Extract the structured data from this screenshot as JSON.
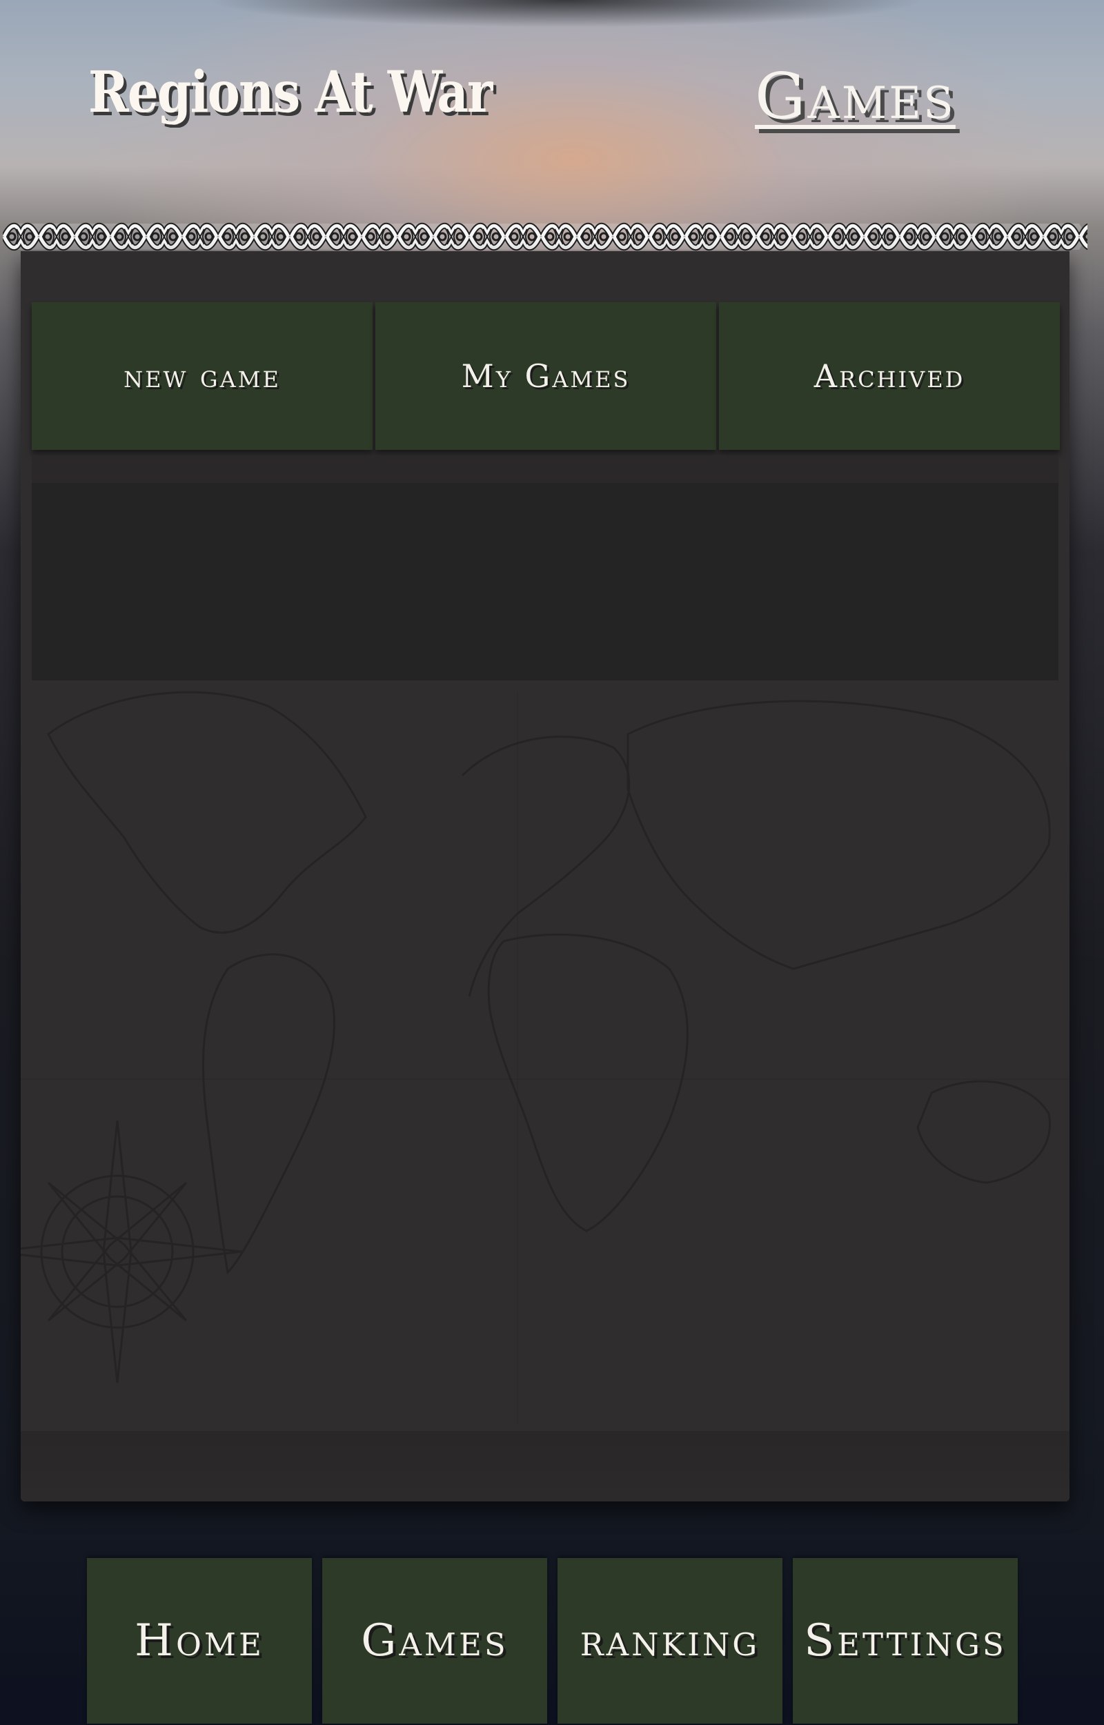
{
  "header": {
    "brand": "Regions At War",
    "nav_link": "Games"
  },
  "tabs": [
    {
      "label": "new game"
    },
    {
      "label": "My Games"
    },
    {
      "label": "Archived"
    }
  ],
  "bottom_nav": [
    {
      "label": "Home"
    },
    {
      "label": "Games"
    },
    {
      "label": "ranking"
    },
    {
      "label": "Settings"
    }
  ],
  "colors": {
    "button_green": "#2d3a27",
    "panel": "#2f2d2d",
    "text_light": "#f3f1ea"
  },
  "icons": {
    "decorative_border": "celtic-knot-border",
    "background": "world-map-with-compass-rose"
  }
}
